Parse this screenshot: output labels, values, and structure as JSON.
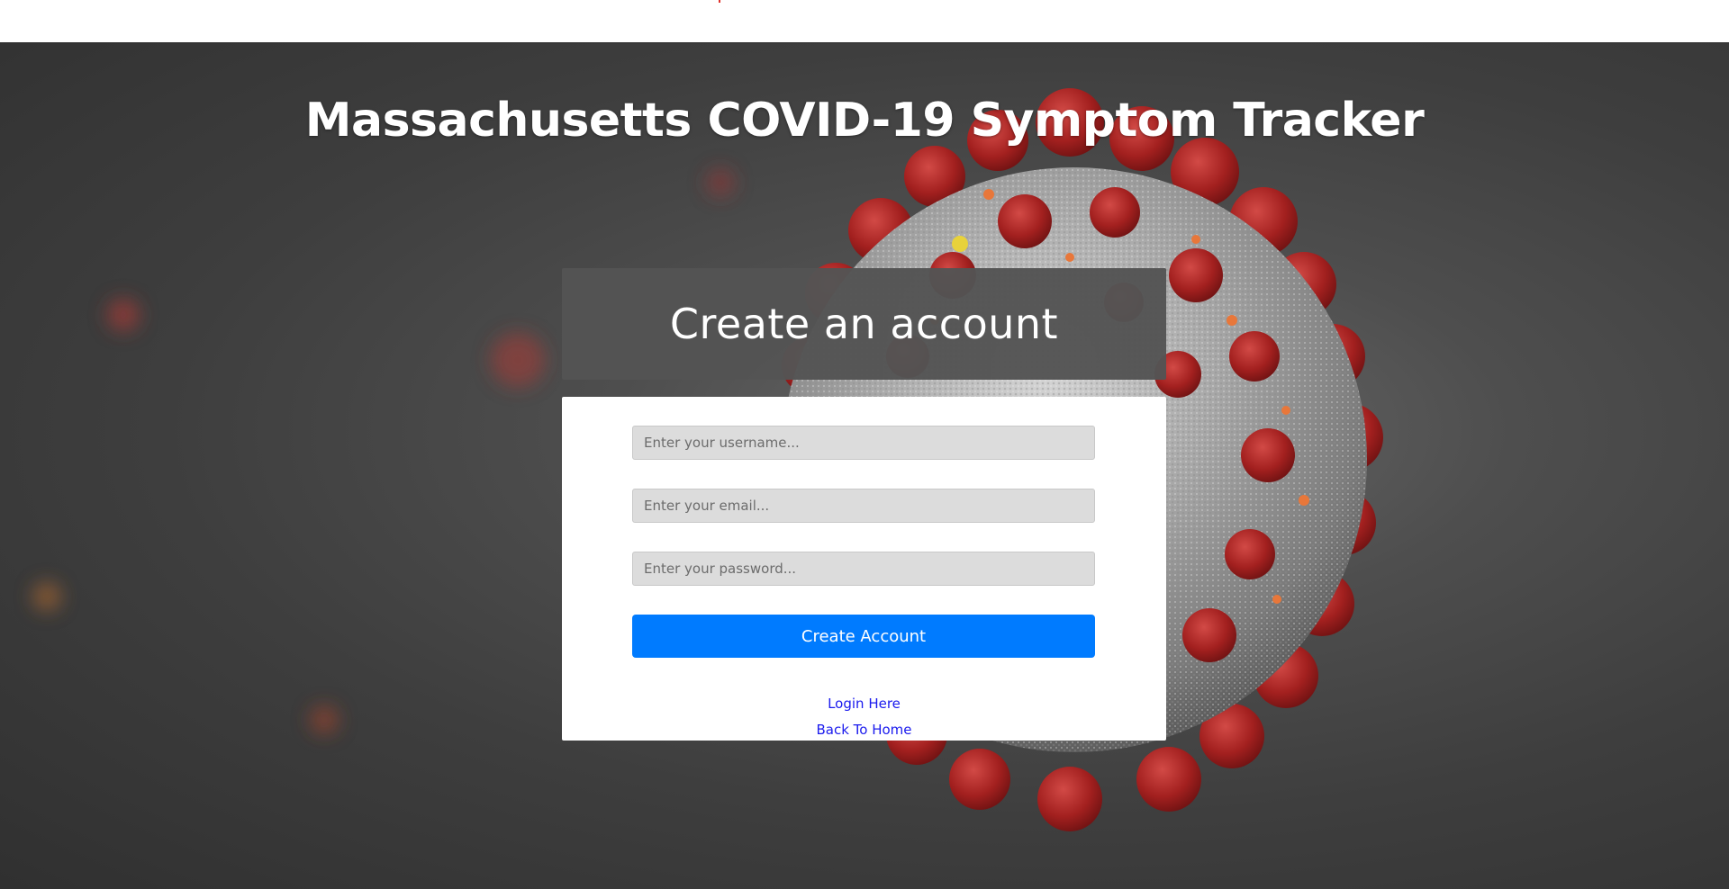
{
  "page": {
    "title": "Massachusetts COVID-19 Symptom Tracker"
  },
  "form": {
    "heading": "Create an account",
    "username_placeholder": "Enter your username...",
    "email_placeholder": "Enter your email...",
    "password_placeholder": "Enter your password...",
    "submit_label": "Create Account",
    "login_link": "Login Here",
    "home_link": "Back To Home"
  },
  "colors": {
    "primary_button": "#007bff",
    "link": "#1a1aee",
    "virus_spike": "#b0282a",
    "virus_body": "#a9a9a9"
  }
}
